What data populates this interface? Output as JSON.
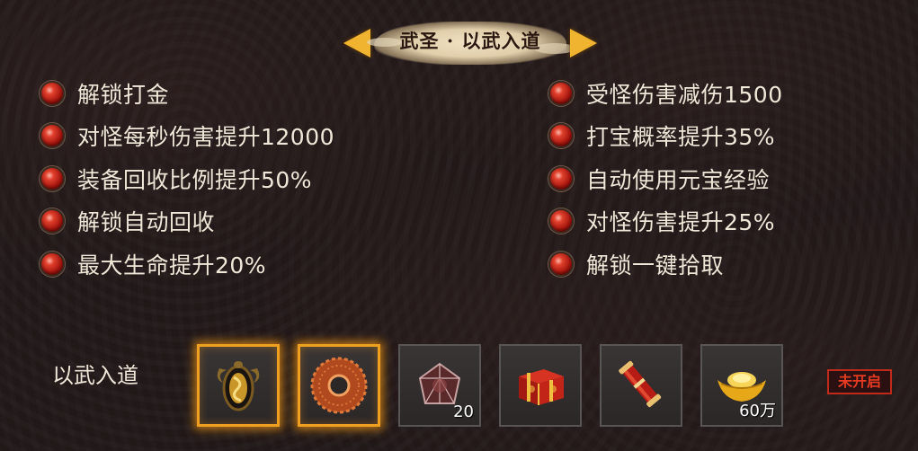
{
  "title": "武圣 · 以武入道",
  "bonuses_left": [
    "解锁打金",
    "对怪每秒伤害提升12000",
    "装备回收比例提升50%",
    "解锁自动回收",
    "最大生命提升20%"
  ],
  "bonuses_right": [
    "受怪伤害减伤1500",
    "打宝概率提升35%",
    "自动使用元宝经验",
    "对怪伤害提升25%",
    "解锁一键拾取"
  ],
  "reward": {
    "label": "以武入道",
    "items": [
      {
        "icon": "gold-amulet-icon",
        "count": "",
        "highlighted": true
      },
      {
        "icon": "jade-ring-icon",
        "count": "",
        "highlighted": true
      },
      {
        "icon": "gem-stone-icon",
        "count": "20",
        "highlighted": false
      },
      {
        "icon": "gift-box-icon",
        "count": "",
        "highlighted": false
      },
      {
        "icon": "scroll-icon",
        "count": "",
        "highlighted": false
      },
      {
        "icon": "gold-ingot-icon",
        "count": "60万",
        "highlighted": false
      }
    ],
    "status": "未开启"
  },
  "colors": {
    "accent_gold": "#f0b430",
    "status_red": "#e63a22",
    "dot_red": "#c81e14"
  }
}
